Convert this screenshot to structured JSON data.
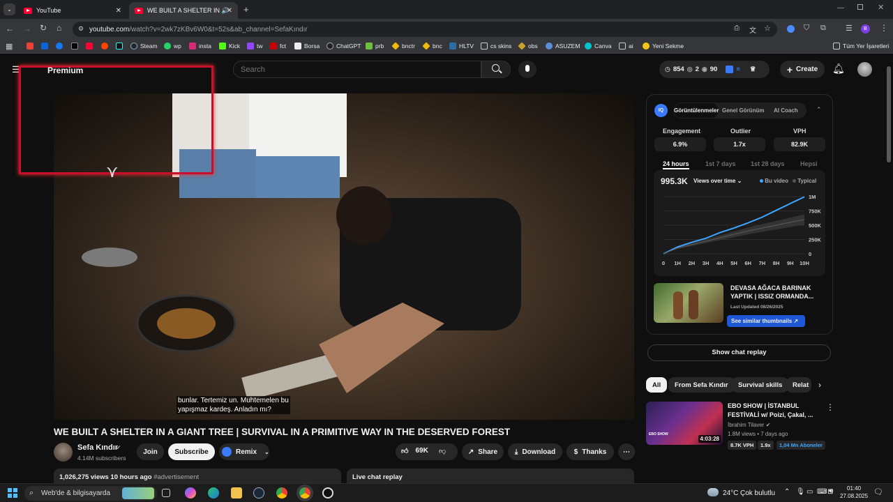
{
  "tabs": [
    {
      "title": "YouTube",
      "active": false
    },
    {
      "title": "WE BUILT A SHELTER IN A G",
      "active": true
    }
  ],
  "url": {
    "host": "youtube.com",
    "path": "/watch?v=2wk7zKBv6W0&t=52s&ab_channel=SefaKındır"
  },
  "bookmarks": [
    "Steam",
    "wp",
    "insta",
    "Kick",
    "tw",
    "fct",
    "Borsa",
    "ChatGPT",
    "prb",
    "bnctr",
    "bnc",
    "HLTV",
    "cs skins",
    "obs",
    "ASUZEM",
    "Canva",
    "ai",
    "Yeni Sekme"
  ],
  "bookmarks_right": "Tüm Yer İşaretleri",
  "header": {
    "premium": "Premium",
    "search_placeholder": "Search",
    "counts": [
      "854",
      "2",
      "90"
    ],
    "create": "Create"
  },
  "video": {
    "caption_line1": "bunlar. Tertemiz un. Muhtemelen bu",
    "caption_line2": "yapışmaz kardeş. Anladın mı?",
    "title": "WE BUILT A SHELTER IN A GIANT TREE | SURVIVAL IN A PRIMITIVE WAY IN THE DESERVED FOREST"
  },
  "channel": {
    "name": "Sefa Kındır",
    "subscribers": "4.14M subscribers",
    "join": "Join",
    "subscribe": "Subscribe",
    "remix": "Remix",
    "likes": "69K",
    "share": "Share",
    "download": "Download",
    "thanks": "Thanks"
  },
  "description": {
    "views_date": "1,026,275 views  10 hours ago",
    "tag": "#advertisement"
  },
  "live_chat_label": "Live chat replay",
  "vidiq": {
    "tabs": [
      "Görüntülenmeler",
      "Genel Görünüm",
      "AI Coach"
    ],
    "stats": [
      {
        "label": "Engagement",
        "value": "6.9%"
      },
      {
        "label": "Outlier",
        "value": "1.7x"
      },
      {
        "label": "VPH",
        "value": "82.9K"
      }
    ],
    "periods": [
      "24 hours",
      "1st 7 days",
      "1st 28 days",
      "Hepsi"
    ],
    "total": "995.3K",
    "metric": "Views over time",
    "legend": [
      "Bu video",
      "Typical"
    ],
    "thumb_title": "DEVASA AĞACA BARINAK YAPTIK | ISSIZ ORMANDA...",
    "last_updated": "Last Updated 08/26/2025",
    "similar": "See similar thumbnails"
  },
  "chart_data": {
    "type": "line",
    "x": [
      "0",
      "1H",
      "2H",
      "3H",
      "4H",
      "5H",
      "6H",
      "7H",
      "8H",
      "9H",
      "10H"
    ],
    "series": [
      {
        "name": "Bu video",
        "values": [
          0,
          120000,
          200000,
          270000,
          370000,
          450000,
          540000,
          640000,
          760000,
          880000,
          995300
        ]
      },
      {
        "name": "Typical",
        "values": [
          0,
          100000,
          160000,
          220000,
          280000,
          340000,
          400000,
          450000,
          500000,
          550000,
          600000
        ]
      }
    ],
    "yticks": [
      "0",
      "250K",
      "500K",
      "750K",
      "1M"
    ],
    "ylim": [
      0,
      1000000
    ],
    "legend": "top-right",
    "colors": {
      "Bu video": "#3ea6ff",
      "Typical": "#555555"
    }
  },
  "show_chat_replay": "Show chat replay",
  "chips": [
    "All",
    "From Sefa Kındır",
    "Survival skills",
    "Relat"
  ],
  "rec": {
    "title": "EBO SHOW | İSTANBUL FESTİVALİ w/ Poizi, Çakal, ...",
    "channel": "İbrahim Tilaver",
    "meta": "1.8M views • 7 days ago",
    "duration": "4:03:28",
    "badges": [
      "8.7K VPH",
      "1.9x",
      "1,04 Mn Aboneler"
    ],
    "thumb_text": "EBO SHOW"
  },
  "taskbar": {
    "search": "Web'de & bilgisayarda",
    "weather_temp": "24°C",
    "weather_text": "Çok bulutlu",
    "time": "01:40",
    "date": "27.08.2025"
  }
}
